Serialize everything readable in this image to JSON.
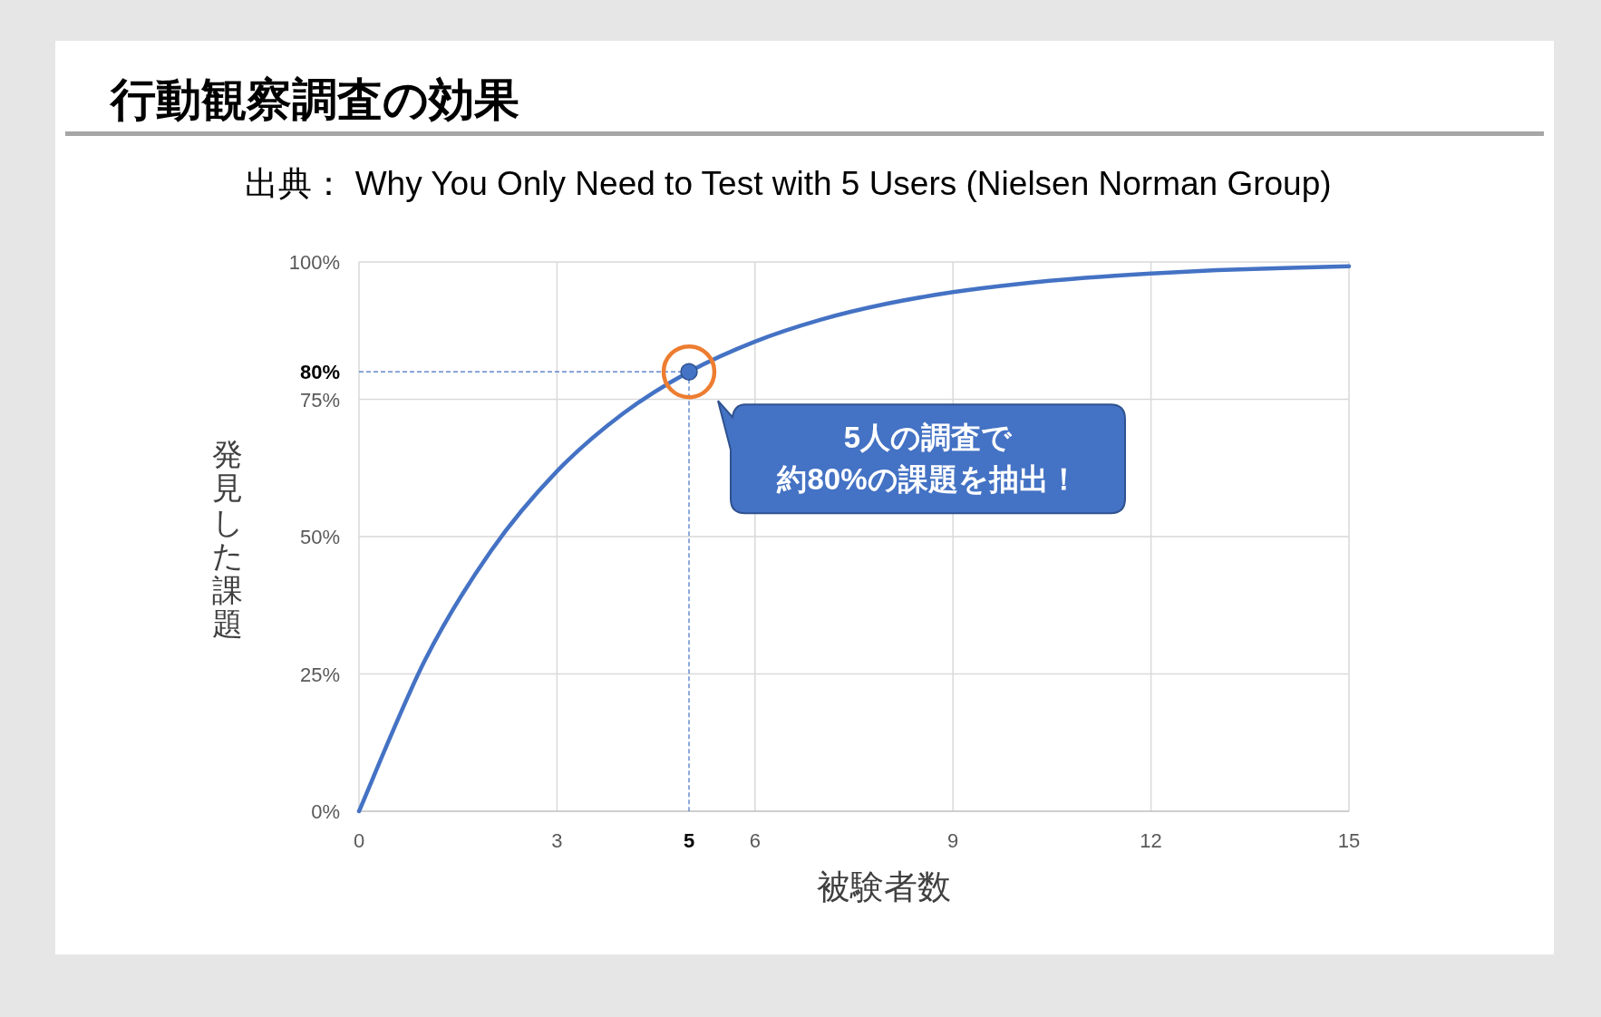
{
  "slide": {
    "title": "行動観察調査の効果",
    "source": "出典： Why You Only Need to Test with 5 Users (Nielsen Norman Group)"
  },
  "chart": {
    "chart_data": {
      "type": "line",
      "xlabel": "被験者数",
      "ylabel": "発見した課題",
      "grid": true,
      "x": [
        0,
        1,
        2,
        3,
        4,
        5,
        6,
        7,
        8,
        9,
        10,
        11,
        12,
        13,
        14,
        15
      ],
      "series": [
        {
          "color": "#4472c4",
          "values": [
            0,
            27.5,
            47.4,
            61.9,
            72.4,
            80.0,
            85.5,
            89.5,
            92.4,
            94.5,
            96.0,
            97.1,
            97.9,
            98.5,
            98.9,
            99.2
          ]
        }
      ],
      "xlim": [
        0,
        15
      ],
      "ylim": [
        0,
        100
      ],
      "xticks": [
        0,
        3,
        5,
        6,
        9,
        12,
        15
      ],
      "yticks": [
        {
          "value": 0,
          "label": "0%"
        },
        {
          "value": 25,
          "label": "25%"
        },
        {
          "value": 50,
          "label": "50%"
        },
        {
          "value": 75,
          "label": "75%"
        },
        {
          "value": 80,
          "label": "80%"
        },
        {
          "value": 100,
          "label": "100%"
        }
      ],
      "ref_lines": [
        {
          "axis": "y",
          "value": 80
        },
        {
          "axis": "x",
          "value": 5
        }
      ],
      "annotations": [
        {
          "text": "5人の調査で"
        },
        {
          "text": "約80%の課題を抽出！"
        }
      ]
    }
  }
}
